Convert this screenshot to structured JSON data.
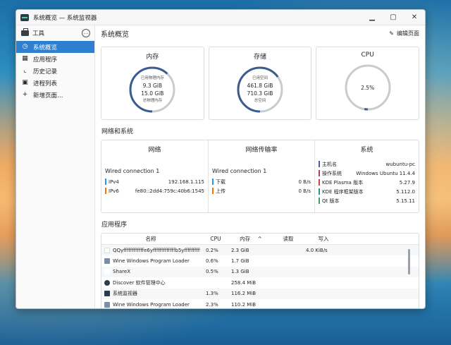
{
  "window": {
    "title": "系统概览 — 系统监视器",
    "controls": {
      "minimize": "▁",
      "maximize": "▢",
      "close": "✕"
    }
  },
  "sidebar": {
    "header_label": "工具",
    "more_icon": "…",
    "items": [
      {
        "label": "系统概览",
        "icon": "speedometer-icon",
        "glyph": "◷",
        "active": true
      },
      {
        "label": "应用程序",
        "icon": "grid-icon",
        "glyph": "▦",
        "active": false
      },
      {
        "label": "历史记录",
        "icon": "chart-icon",
        "glyph": "⌞",
        "active": false
      },
      {
        "label": "进程列表",
        "icon": "process-icon",
        "glyph": "▣",
        "active": false
      },
      {
        "label": "新增页面…",
        "icon": "plus-icon",
        "glyph": "+",
        "active": false
      }
    ]
  },
  "page": {
    "title": "系统概览",
    "edit_label": "编辑页面",
    "edit_icon": "✎"
  },
  "cards": {
    "memory": {
      "title": "内存",
      "used_label": "已用物理内存",
      "used_value": "9.3 GiB",
      "total_value": "15.0 GiB",
      "total_label": "总物理内存",
      "fraction": 0.62
    },
    "storage": {
      "title": "存储",
      "used_label": "已用空间",
      "used_value": "461.8 GiB",
      "total_value": "710.3 GiB",
      "total_label": "总空间",
      "fraction": 0.65
    },
    "cpu": {
      "title": "CPU",
      "value": "2.5%",
      "fraction": 0.025
    }
  },
  "network_section": {
    "title": "网络和系统",
    "network": {
      "title": "网络",
      "connection": "Wired connection 1",
      "rows": [
        {
          "key": "IPv4",
          "value": "192.168.1.115",
          "color": "#1d99f3"
        },
        {
          "key": "IPv6",
          "value": "fe80::2dd4:759c:40b6:1545",
          "color": "#f67400"
        }
      ]
    },
    "rate": {
      "title": "网络传输率",
      "connection": "Wired connection 1",
      "rows": [
        {
          "key": "下载",
          "value": "0 B/s",
          "color": "#1d99f3"
        },
        {
          "key": "上传",
          "value": "0 B/s",
          "color": "#f67400"
        }
      ]
    },
    "system": {
      "title": "系统",
      "rows": [
        {
          "key": "主机名",
          "value": "wubuntu-pc",
          "color": "#4e5b9c"
        },
        {
          "key": "操作系统",
          "value": "Windows Ubuntu 11.4.4",
          "color": "#b33a68"
        },
        {
          "key": "KDE Plasma 版本",
          "value": "5.27.9",
          "color": "#c04a3b"
        },
        {
          "key": "KDE 程序框架版本",
          "value": "5.112.0",
          "color": "#2f8f88"
        },
        {
          "key": "Qt 版本",
          "value": "5.15.11",
          "color": "#3aa35a"
        }
      ]
    }
  },
  "apps_section": {
    "title": "应用程序",
    "columns": {
      "name": "名称",
      "cpu": "CPU",
      "memory": "内存",
      "sort_indicator": "^",
      "read": "读取",
      "write": "写入"
    },
    "rows": [
      {
        "name": "QQyffffffffffffe6yfffffffffffffb5yffffffffff…",
        "cpu": "0.2%",
        "memory": "2.3 GiB",
        "read": "",
        "write": "4.0 KiB/s",
        "icon_color": "#ffffff"
      },
      {
        "name": "Wine Windows Program Loader",
        "cpu": "0.6%",
        "memory": "1.7 GiB",
        "read": "",
        "write": "",
        "icon_color": "#7a8ea8"
      },
      {
        "name": "ShareX",
        "cpu": "0.5%",
        "memory": "1.3 GiB",
        "read": "",
        "write": "",
        "icon_color": "#ffffff"
      },
      {
        "name": "Discover 软件管理中心",
        "cpu": "",
        "memory": "258.4 MiB",
        "read": "",
        "write": "",
        "icon_color": "#2c3e50"
      },
      {
        "name": "系统监视器",
        "cpu": "1.3%",
        "memory": "116.2 MiB",
        "read": "",
        "write": "",
        "icon_color": "#2b3a4a"
      },
      {
        "name": "Wine Windows Program Loader",
        "cpu": "2.3%",
        "memory": "110.2 MiB",
        "read": "",
        "write": "",
        "icon_color": "#7a8ea8"
      }
    ]
  }
}
